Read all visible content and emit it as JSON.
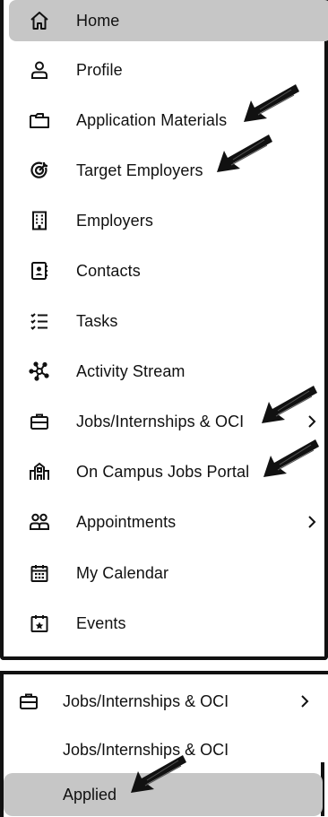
{
  "nav": {
    "items": [
      {
        "label": "Home",
        "icon": "home-icon",
        "active": true
      },
      {
        "label": "Profile",
        "icon": "profile-icon"
      },
      {
        "label": "Application Materials",
        "icon": "folder-icon"
      },
      {
        "label": "Target Employers",
        "icon": "target-icon"
      },
      {
        "label": "Employers",
        "icon": "building-icon"
      },
      {
        "label": "Contacts",
        "icon": "contact-card-icon"
      },
      {
        "label": "Tasks",
        "icon": "tasks-icon"
      },
      {
        "label": "Activity Stream",
        "icon": "activity-icon"
      },
      {
        "label": "Jobs/Internships & OCI",
        "icon": "briefcase-icon",
        "expandable": true
      },
      {
        "label": "On Campus Jobs Portal",
        "icon": "campus-icon"
      },
      {
        "label": "Appointments",
        "icon": "people-icon",
        "expandable": true
      },
      {
        "label": "My Calendar",
        "icon": "calendar-icon"
      },
      {
        "label": "Events",
        "icon": "event-star-icon"
      }
    ]
  },
  "submenu": {
    "parent_label": "Jobs/Internships & OCI",
    "child_label": "Jobs/Internships & OCI",
    "applied_label": "Applied"
  },
  "colors": {
    "active_bg": "#c6c6c6",
    "border": "#111111"
  }
}
